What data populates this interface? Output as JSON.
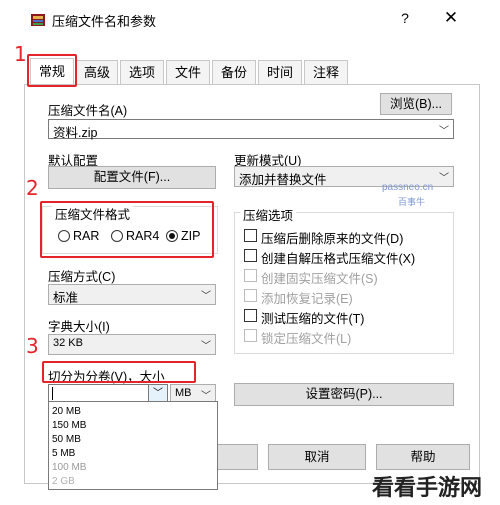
{
  "window": {
    "title": "压缩文件名和参数",
    "help_label": "?",
    "close_label": "✕"
  },
  "tabs": [
    {
      "label": "常规"
    },
    {
      "label": "高级"
    },
    {
      "label": "选项"
    },
    {
      "label": "文件"
    },
    {
      "label": "备份"
    },
    {
      "label": "时间"
    },
    {
      "label": "注释"
    }
  ],
  "archive_name": {
    "label": "压缩文件名(A)",
    "value": "资料.zip",
    "browse_label": "浏览(B)..."
  },
  "default_profile": {
    "label": "默认配置",
    "button_label": "配置文件(F)..."
  },
  "update_mode": {
    "label": "更新模式(U)",
    "value": "添加并替换文件"
  },
  "archive_format": {
    "title": "压缩文件格式",
    "options": [
      "RAR",
      "RAR4",
      "ZIP"
    ],
    "selected": "ZIP"
  },
  "archive_options": {
    "title": "压缩选项",
    "items": [
      {
        "label": "压缩后删除原来的文件(D)",
        "enabled": true
      },
      {
        "label": "创建自解压格式压缩文件(X)",
        "enabled": true
      },
      {
        "label": "创建固实压缩文件(S)",
        "enabled": false
      },
      {
        "label": "添加恢复记录(E)",
        "enabled": false
      },
      {
        "label": "测试压缩的文件(T)",
        "enabled": true
      },
      {
        "label": "锁定压缩文件(L)",
        "enabled": false
      }
    ]
  },
  "compression_method": {
    "label": "压缩方式(C)",
    "value": "标准"
  },
  "dictionary_size": {
    "label": "字典大小(I)",
    "value": "32 KB"
  },
  "split_volumes": {
    "label": "切分为分卷(V)，大小",
    "value": "",
    "unit": "MB",
    "options": [
      "20 MB",
      "150 MB",
      "50 MB",
      "5 MB",
      "100 MB",
      "2 GB"
    ]
  },
  "buttons": {
    "set_password": "设置密码(P)...",
    "ok": "定",
    "cancel": "取消",
    "help": "帮助"
  },
  "annotations": {
    "num1": "1",
    "num2": "2",
    "num3": "3"
  },
  "watermarks": {
    "site": "passneo.cn",
    "site_cn": "百事牛",
    "brand": "看看手游网"
  },
  "colors": {
    "highlight_red": "#e5232a",
    "watermark_blue": "#7d9ad0"
  }
}
